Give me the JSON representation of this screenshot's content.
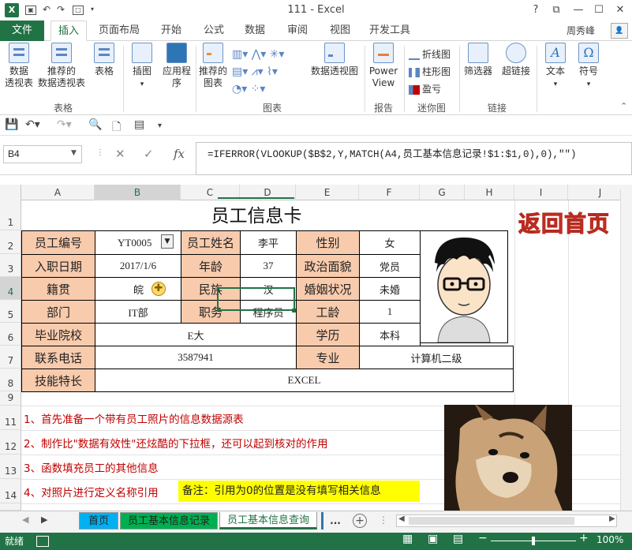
{
  "window": {
    "title": "111 - Excel",
    "help": "?",
    "restore_ribbon": "⧉",
    "minimize": "—",
    "maximize": "☐",
    "close": "✕"
  },
  "menu": {
    "file": "文件",
    "tabs": [
      "插入",
      "页面布局",
      "开始",
      "公式",
      "数据",
      "审阅",
      "视图",
      "开发工具"
    ],
    "user": "周秀峰",
    "active_tab": "插入"
  },
  "ribbon": {
    "pivot_table": "数据\n透视表",
    "recommended_pivot": "推荐的\n数据透视表",
    "table": "表格",
    "illustrations": "插图",
    "apps": "应用程\n序",
    "recommended_charts": "推荐的\n图表",
    "pivot_chart": "数据透视图",
    "power_view": "Power\nView",
    "spark_line": "折线图",
    "spark_column": "柱形图",
    "spark_winloss": "盈亏",
    "slicer": "筛选器",
    "hyperlink": "超链接",
    "text": "文本",
    "symbol": "符号",
    "groups": {
      "tables": "表格",
      "charts": "图表",
      "reports": "报告",
      "sparklines": "迷你图",
      "links": "链接"
    }
  },
  "formula_bar": {
    "name_box": "B4",
    "formula": "=IFERROR(VLOOKUP($B$2,Y,MATCH(A4,员工基本信息记录!$1:$1,0),0),\"\")"
  },
  "columns": [
    "A",
    "B",
    "C",
    "D",
    "E",
    "F",
    "G",
    "H",
    "I",
    "J"
  ],
  "rows": [
    "1",
    "2",
    "3",
    "4",
    "5",
    "6",
    "7",
    "8",
    "9",
    "11",
    "12",
    "13",
    "14"
  ],
  "card": {
    "title": "员工信息卡",
    "back_home": "返回首页",
    "employee_id_label": "员工编号",
    "employee_id": "YT0005",
    "name_label": "员工姓名",
    "name": "李平",
    "gender_label": "性别",
    "gender": "女",
    "hire_date_label": "入职日期",
    "hire_date": "2017/1/6",
    "age_label": "年龄",
    "age": "37",
    "politics_label": "政治面貌",
    "politics": "党员",
    "origin_label": "籍贯",
    "origin": "皖",
    "ethnic_label": "民族",
    "ethnic": "汉",
    "marital_label": "婚姻状况",
    "marital": "未婚",
    "dept_label": "部门",
    "dept": "IT部",
    "position_label": "职务",
    "position": "程序员",
    "seniority_label": "工龄",
    "seniority": "1",
    "school_label": "毕业院校",
    "school": "E大",
    "education_label": "学历",
    "education": "本科",
    "phone_label": "联系电话",
    "phone": "3587941",
    "major_label": "专业",
    "major": "计算机二级",
    "skills_label": "技能特长",
    "skills": "EXCEL"
  },
  "notes": [
    "1、首先准备一个带有员工照片的信息数据源表",
    "2、制作比\"数据有效性\"还炫酷的下拉框，还可以起到核对的作用",
    "3、函数填充员工的其他信息",
    "4、对照片进行定义名称引用"
  ],
  "remark": "备注：引用为0的位置是没有填写相关信息",
  "sheets": {
    "home": "首页",
    "records": "员工基本信息记录",
    "query": "员工基本信息查询",
    "more": "..."
  },
  "status": {
    "ready": "就绪",
    "zoom": "100%"
  },
  "colors": {
    "excel_green": "#217346",
    "label_fill": "#f8cbad",
    "highlight": "#ffff00",
    "note_red": "#c00000",
    "back_home_red": "#e8584a"
  }
}
